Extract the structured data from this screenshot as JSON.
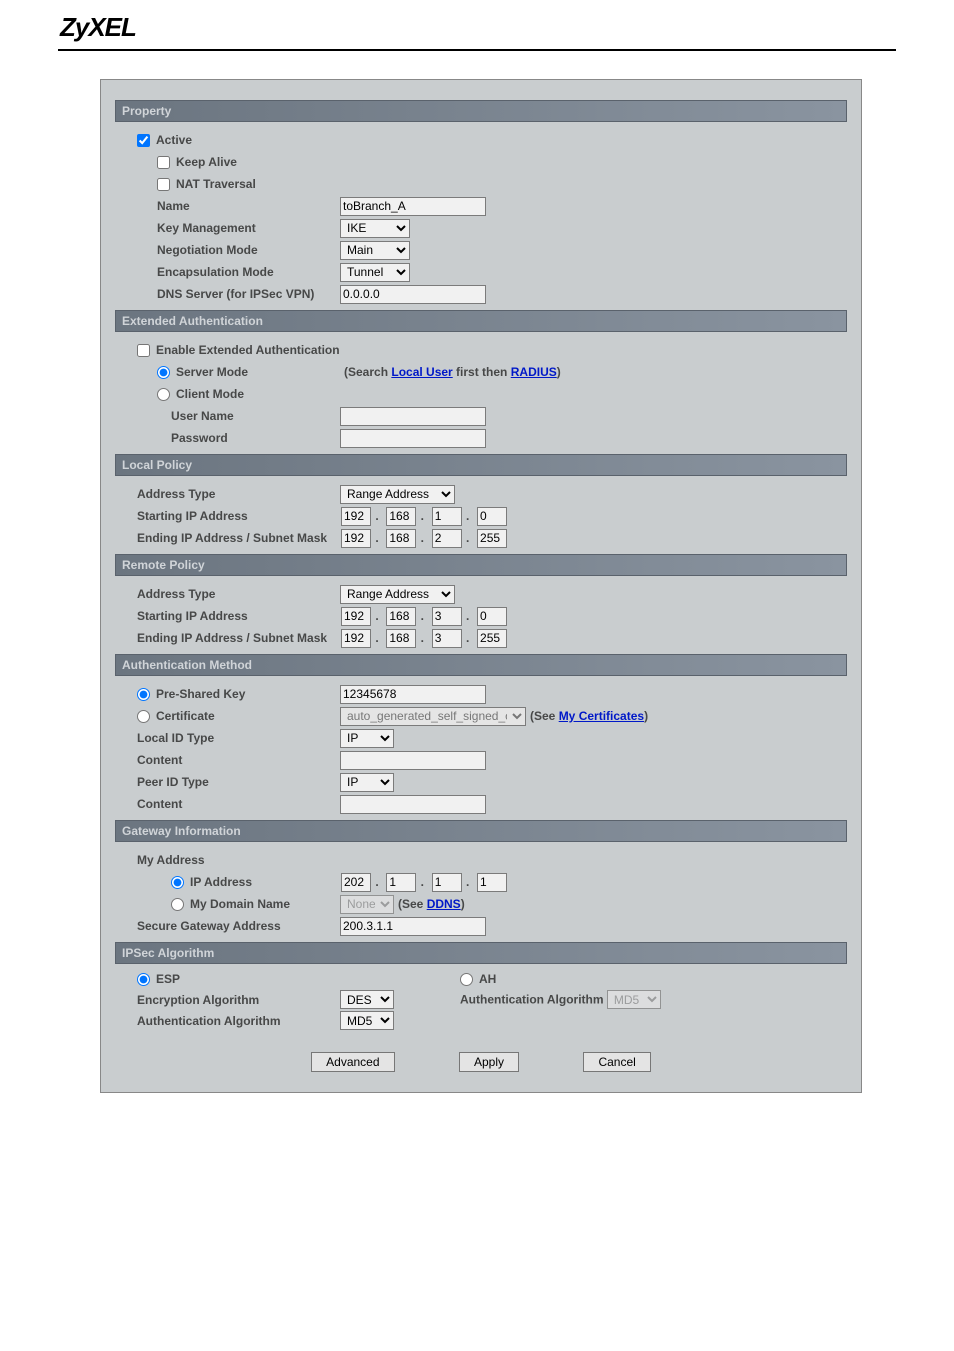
{
  "brand": "ZyXEL",
  "sections": {
    "property": "Property",
    "extauth": "Extended Authentication",
    "localpolicy": "Local Policy",
    "remotepolicy": "Remote Policy",
    "authmethod": "Authentication Method",
    "gateway": "Gateway Information",
    "ipsecalg": "IPSec Algorithm"
  },
  "property": {
    "active": "Active",
    "keepalive": "Keep Alive",
    "nattrav": "NAT Traversal",
    "name_lbl": "Name",
    "name_val": "toBranch_A",
    "keymgmt_lbl": "Key Management",
    "keymgmt_val": "IKE",
    "negmode_lbl": "Negotiation Mode",
    "negmode_val": "Main",
    "encap_lbl": "Encapsulation Mode",
    "encap_val": "Tunnel",
    "dns_lbl": "DNS Server (for IPSec VPN)",
    "dns_val": "0.0.0.0"
  },
  "extauth": {
    "enable": "Enable Extended Authentication",
    "server": "Server Mode",
    "server_after1": "(Search ",
    "server_link1": "Local User",
    "server_after2": " first then ",
    "server_link2": "RADIUS",
    "server_after3": ")",
    "client": "Client Mode",
    "user_lbl": "User Name",
    "user_val": "",
    "pass_lbl": "Password",
    "pass_val": ""
  },
  "localpolicy": {
    "addrtype_lbl": "Address Type",
    "addrtype_val": "Range Address",
    "start_lbl": "Starting IP Address",
    "start": {
      "a": "192",
      "b": "168",
      "c": "1",
      "d": "0"
    },
    "end_lbl": "Ending IP Address / Subnet Mask",
    "end": {
      "a": "192",
      "b": "168",
      "c": "2",
      "d": "255"
    }
  },
  "remotepolicy": {
    "addrtype_lbl": "Address Type",
    "addrtype_val": "Range Address",
    "start_lbl": "Starting IP Address",
    "start": {
      "a": "192",
      "b": "168",
      "c": "3",
      "d": "0"
    },
    "end_lbl": "Ending IP Address / Subnet Mask",
    "end": {
      "a": "192",
      "b": "168",
      "c": "3",
      "d": "255"
    }
  },
  "authmethod": {
    "psk": "Pre-Shared Key",
    "psk_val": "12345678",
    "cert": "Certificate",
    "cert_val": "auto_generated_self_signed_cert",
    "cert_after1": " (See ",
    "cert_link": "My Certificates",
    "cert_after2": ")",
    "localid_lbl": "Local ID Type",
    "localid_val": "IP",
    "content1_lbl": "Content",
    "content1_val": "",
    "peerid_lbl": "Peer ID Type",
    "peerid_val": "IP",
    "content2_lbl": "Content",
    "content2_val": ""
  },
  "gateway": {
    "myaddr": "My Address",
    "ipaddr": "IP Address",
    "ip": {
      "a": "202",
      "b": "1",
      "c": "1",
      "d": "1"
    },
    "domain": "My Domain Name",
    "domain_val": "None",
    "domain_after1": " (See ",
    "domain_link": "DDNS",
    "domain_after2": ")",
    "secgw_lbl": "Secure Gateway Address",
    "secgw_val": "200.3.1.1"
  },
  "ipsecalg": {
    "esp": "ESP",
    "ah": "AH",
    "encalg_lbl": "Encryption Algorithm",
    "encalg_val": "DES",
    "authalg_mid_lbl": "Authentication Algorithm",
    "authalg_mid_val": "MD5",
    "authalg_lbl": "Authentication Algorithm",
    "authalg_val": "MD5"
  },
  "buttons": {
    "advanced": "Advanced",
    "apply": "Apply",
    "cancel": "Cancel"
  }
}
